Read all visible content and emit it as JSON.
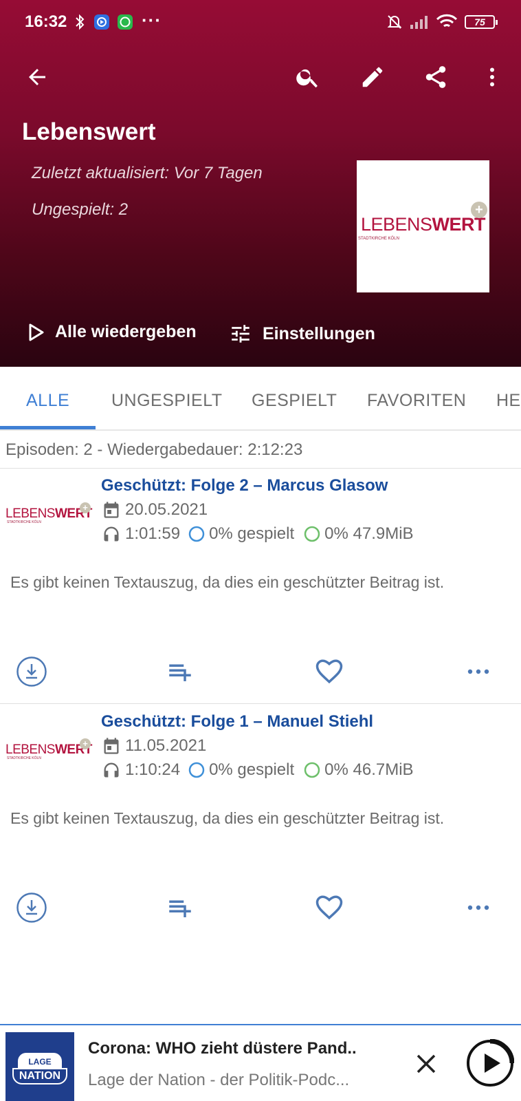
{
  "status_bar": {
    "time": "16:32",
    "dots": "···",
    "battery": "75"
  },
  "podcast": {
    "title": "Lebenswert",
    "last_updated": "Zuletzt aktualisiert: Vor 7 Tagen",
    "unplayed": "Ungespielt: 2",
    "cover_text_light": "LEBENS",
    "cover_text_bold": "WERT",
    "cover_sub": "STADTKIRCHE KÖLN",
    "badge": "+"
  },
  "actions": {
    "play_all": "Alle wiedergeben",
    "settings": "Einstellungen"
  },
  "tabs": [
    {
      "label": "ALLE",
      "active": true
    },
    {
      "label": "UNGESPIELT",
      "active": false
    },
    {
      "label": "GESPIELT",
      "active": false
    },
    {
      "label": "FAVORITEN",
      "active": false
    },
    {
      "label": "HE",
      "active": false
    }
  ],
  "summary": "Episoden: 2 - Wiedergabedauer: 2:12:23",
  "episodes": [
    {
      "title": "Geschützt: Folge 2 – Marcus Glasow",
      "date": "20.05.2021",
      "duration": "1:01:59",
      "played": "0% gespielt",
      "downloaded": "0% 47.9MiB",
      "description": "Es gibt keinen Textauszug, da dies ein geschützter Beitrag ist."
    },
    {
      "title": "Geschützt: Folge 1 – Manuel Stiehl",
      "date": "11.05.2021",
      "duration": "1:10:24",
      "played": "0% gespielt",
      "downloaded": "0% 46.7MiB",
      "description": "Es gibt keinen Textauszug, da dies ein geschützter Beitrag ist."
    }
  ],
  "player": {
    "title": "Corona: WHO zieht düstere Pand..",
    "subtitle": "Lage der Nation - der Politik-Podc...",
    "art_top": "LAGE",
    "art_bottom": "NATION"
  },
  "colors": {
    "header_top": "#960c35",
    "header_bottom": "#2a0410",
    "accent": "#3f7fd4",
    "episode_title": "#1a4d9c",
    "brand_red": "#b3143f"
  },
  "icons": [
    "back-arrow-icon",
    "search-icon",
    "edit-icon",
    "share-icon",
    "more-vert-icon",
    "play-icon",
    "tune-icon",
    "calendar-icon",
    "headphones-icon",
    "download-icon",
    "playlist-add-icon",
    "heart-icon",
    "more-horiz-icon",
    "close-icon",
    "play-circle-icon"
  ]
}
